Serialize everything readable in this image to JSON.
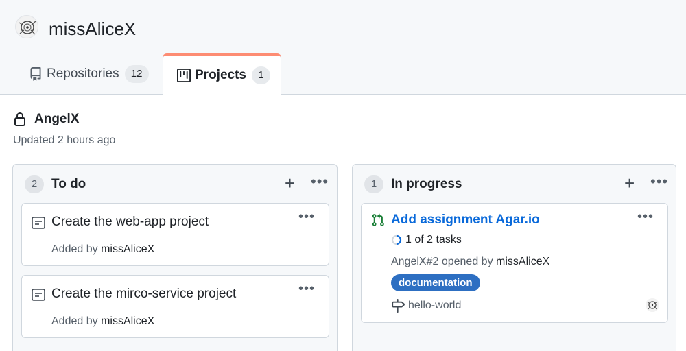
{
  "owner": {
    "name": "missAliceX"
  },
  "tabs": [
    {
      "label": "Repositories",
      "count": "12",
      "icon": "repo-icon"
    },
    {
      "label": "Projects",
      "count": "1",
      "icon": "project-icon"
    }
  ],
  "project": {
    "title": "AngelX",
    "updated": "Updated 2 hours ago"
  },
  "columns": [
    {
      "count": "2",
      "title": "To do",
      "add": "+",
      "more": "•••",
      "cards": [
        {
          "text": "Create the web-app project",
          "meta_prefix": "Added by",
          "user": "missAliceX",
          "more": "•••"
        },
        {
          "text": "Create the mirco-service project",
          "meta_prefix": "Added by",
          "user": "missAliceX",
          "more": "•••"
        }
      ]
    },
    {
      "count": "1",
      "title": "In progress",
      "add": "+",
      "more": "•••",
      "cards": [
        {
          "title": "Add assignment Agar.io",
          "tasks": "1 of 2 tasks",
          "tasks_done": 1,
          "tasks_total": 2,
          "meta_prefix": "AngelX#2 opened by",
          "user": "missAliceX",
          "label": "documentation",
          "label_color": "#2d6fc2",
          "milestone": "hello-world",
          "more": "•••"
        }
      ]
    }
  ],
  "colors": {
    "accent_tab": "#fd8c73",
    "link": "#0969da",
    "pr_open": "#1a7f37"
  }
}
